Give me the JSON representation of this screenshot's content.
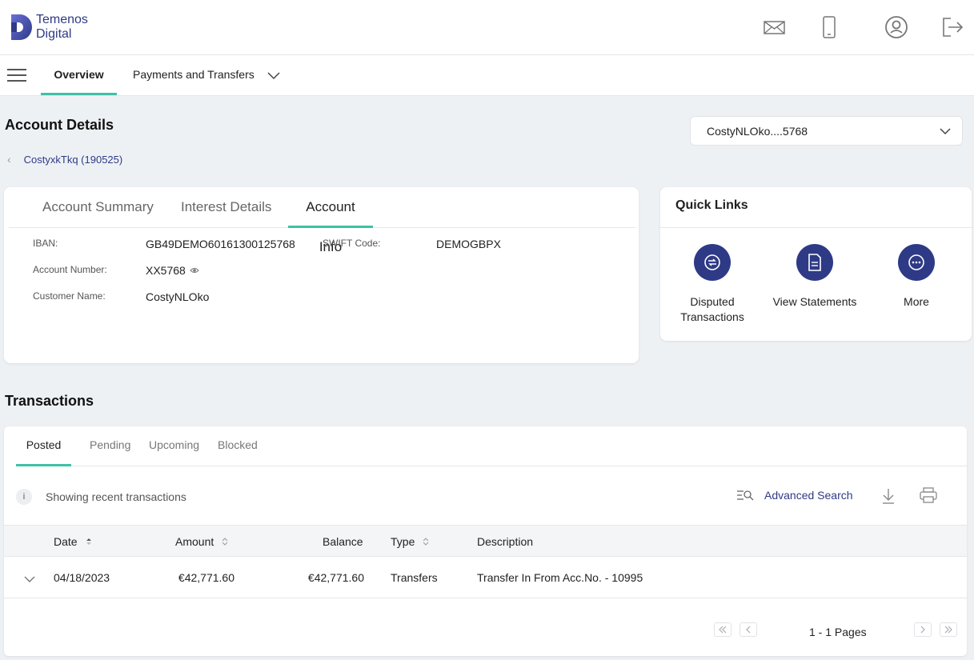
{
  "brand": {
    "line1": "Temenos",
    "line2": "Digital"
  },
  "header_icons": [
    "mail-icon",
    "mobile-icon",
    "user-profile-icon",
    "logout-icon"
  ],
  "nav": {
    "tabs": [
      {
        "label": "Overview",
        "active": true
      },
      {
        "label": "Payments and Transfers",
        "active": false
      }
    ]
  },
  "page": {
    "title": "Account Details",
    "breadcrumb": "CostyxkTkq (190525)",
    "account_selector": "CostyNLOko....5768"
  },
  "details": {
    "tabs": [
      {
        "label": "Account Summary"
      },
      {
        "label": "Interest Details"
      },
      {
        "label": "Account Info",
        "active": true
      }
    ],
    "fields": {
      "iban_label": "IBAN:",
      "iban_value": "GB49DEMO60161300125768",
      "account_number_label": "Account Number:",
      "account_number_value": "XX5768",
      "customer_name_label": "Customer Name:",
      "customer_name_value": "CostyNLOko",
      "swift_label": "SWIFT Code:",
      "swift_value": "DEMOGBPX"
    }
  },
  "quick_links": {
    "title": "Quick Links",
    "items": [
      {
        "label": "Disputed Transactions",
        "icon": "dispute-icon"
      },
      {
        "label": "View Statements",
        "icon": "statement-icon"
      },
      {
        "label": "More",
        "icon": "more-icon"
      }
    ]
  },
  "transactions": {
    "title": "Transactions",
    "tabs": [
      {
        "label": "Posted",
        "active": true
      },
      {
        "label": "Pending"
      },
      {
        "label": "Upcoming"
      },
      {
        "label": "Blocked"
      }
    ],
    "info_text": "Showing recent transactions",
    "advanced_search": "Advanced Search",
    "columns": [
      "Date",
      "Amount",
      "Balance",
      "Type",
      "Description"
    ],
    "rows": [
      {
        "date": "04/18/2023",
        "amount": "€42,771.60",
        "balance": "€42,771.60",
        "type": "Transfers",
        "description": "Transfer In From Acc.No. - 10995"
      }
    ],
    "pagination": "1 - 1 Pages"
  },
  "colors": {
    "brand": "#2e3a86",
    "accent": "#3fc1a5",
    "background": "#eef1f4"
  }
}
